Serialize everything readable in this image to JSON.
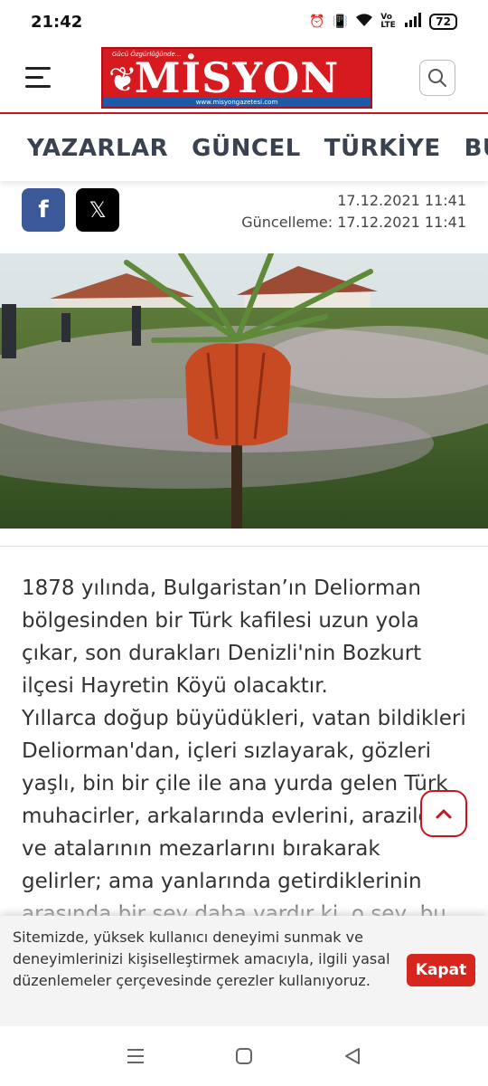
{
  "status": {
    "time": "21:42",
    "battery": "72",
    "network": "Vo LTE"
  },
  "header": {
    "logo_text": "MİSYON",
    "logo_tagline": "Gücü Özgürlüğünde...",
    "logo_url": "www.misyongazetesi.com"
  },
  "nav": {
    "items": [
      "YAZARLAR",
      "GÜNCEL",
      "TÜRKİYE",
      "BUL"
    ]
  },
  "share": {
    "facebook": "f",
    "x": "𝕏"
  },
  "dates": {
    "published": "17.12.2021 11:41",
    "updated": "Güncelleme: 17.12.2021 11:41"
  },
  "article": {
    "paragraphs": [
      "1878 yılında, Bulgaristan’ın Deliorman bölgesinden bir Türk kafilesi uzun yola çıkar, son durakları Denizli'nin Bozkurt ilçesi Hayretin Köyü olacaktır.",
      "Yıllarca doğup büyüdükleri, vatan bildikleri Deliorman'dan, içleri sızlayarak, gözleri yaşlı, bin bir çile ile ana yurda gelen Türk muhacirler, arkalarında evlerini, arazilerini ve atalarının mezarlarını bırakarak gelirler; ama yanlarında getirdiklerinin arasında bir şey daha vardır ki, o şey, bu köyün ve bu"
    ]
  },
  "cookie": {
    "text": "Sitemizde, yüksek kullanıcı deneyimi sunmak ve deneyimlerinizi kişiselleştirmek amacıyla, ilgili yasal düzenlemeler çerçevesinde çerezler kullanıyoruz.",
    "button": "Kapat"
  },
  "colors": {
    "brand_red": "#c4161c",
    "facebook": "#3b5998",
    "cookie_button": "#d7261e"
  }
}
